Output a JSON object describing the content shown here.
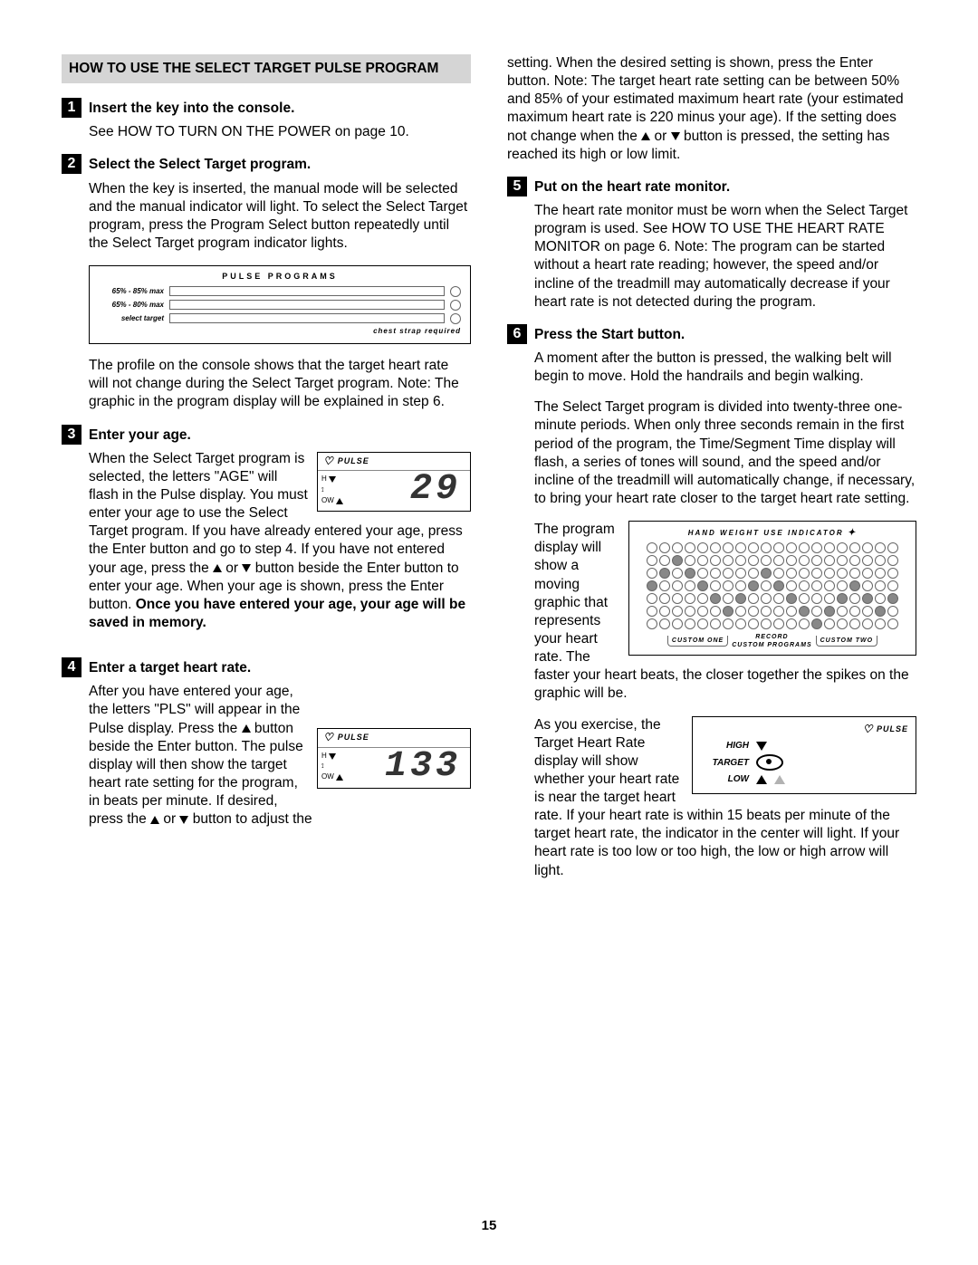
{
  "page_number": "15",
  "section_title": "HOW TO USE THE SELECT TARGET PULSE PROGRAM",
  "steps": [
    {
      "num": "1",
      "title": "Insert the key into the console."
    },
    {
      "num": "2",
      "title": "Select the Select Target program."
    },
    {
      "num": "3",
      "title": "Enter your age."
    },
    {
      "num": "4",
      "title": "Enter a target heart rate."
    },
    {
      "num": "5",
      "title": "Put on the heart rate monitor."
    },
    {
      "num": "6",
      "title": "Press the Start button."
    }
  ],
  "body": {
    "p1": "See HOW TO TURN ON THE POWER on page 10.",
    "p2": "When the key is inserted, the manual mode will be selected and the manual indicator will light. To select the Select Target program, press the Program Select button repeatedly until the Select Target program indicator lights.",
    "p3": "The profile on the console shows that the target heart rate will not change during the Select Target program. Note: The graphic in the program display will be explained in step 6.",
    "p4a": "When the Select Target program is selected, the letters \"AGE\" will flash in the Pulse display. You must enter your age to use the Select Target program. If you have already entered your age, press the Enter button and go to step 4. If you have not entered your age, press the ",
    "p4b": " or ",
    "p4c": " button beside the Enter button to enter your age. When your age is shown, press the Enter button. ",
    "p4bold": "Once you have entered your age, your age will be saved in memory.",
    "p5a": "After you have entered your age, the letters \"PLS\" will appear in the Pulse display. Press the ",
    "p5b": " button beside the Enter button. The pulse display will then show the target heart rate setting for the program, in beats per minute. If desired, press the ",
    "p5c": " or ",
    "p5d": " button to adjust the ",
    "p6a": "setting. When the desired setting is shown, press the Enter button. Note: The target heart rate setting can be between 50% and 85% of your estimated maximum heart rate (your estimated maximum heart rate is 220 minus your age). If the setting does not change when the ",
    "p6b": " or ",
    "p6c": " button is pressed, the setting has reached its high or low limit.",
    "p7": "The heart rate monitor must be worn when the Select Target program is used. See HOW TO USE THE HEART RATE MONITOR on page 6. Note: The program can be started without a heart rate reading; however, the speed and/or incline of the treadmill may automatically decrease if your heart rate is not detected during the program.",
    "p8": "A moment after the button is pressed, the walking belt will begin to move. Hold the handrails and begin walking.",
    "p9": "The Select Target program is divided into twenty-three one-minute periods. When only three seconds remain in the first period of the program, the Time/Segment Time display will flash, a series of tones will sound, and the speed and/or incline of the treadmill will automatically change, if necessary, to bring your heart rate closer to the target heart rate setting.",
    "p10": "The program display will show a moving graphic that represents your heart rate. The faster your heart beats, the closer together the spikes on the graphic will be.",
    "p11": "As you exercise, the Target Heart Rate display will show whether your heart rate is near the target heart rate. If your heart rate is within 15 beats per minute of the target heart rate, the indicator in the center will light. If your heart rate is too low or too high, the low or high arrow will light."
  },
  "fig_pulse_programs": {
    "title": "PULSE PROGRAMS",
    "row1": "65% - 85% max",
    "row2": "65% - 80% max",
    "row3": "select target",
    "footer": "chest strap required"
  },
  "fig_pulse_lcd": {
    "header": "PULSE",
    "high_lbl": "H",
    "low_lbl": "OW",
    "value_age": "29",
    "value_pls": "133"
  },
  "fig_hand_weight": {
    "title": "HAND WEIGHT USE INDICATOR",
    "foot_left": "CUSTOM ONE",
    "foot_mid_top": "RECORD",
    "foot_mid_bottom": "CUSTOM PROGRAMS",
    "foot_right": "CUSTOM TWO"
  },
  "fig_target_hr": {
    "header": "PULSE",
    "high": "HIGH",
    "target": "TARGET",
    "low": "LOW"
  }
}
